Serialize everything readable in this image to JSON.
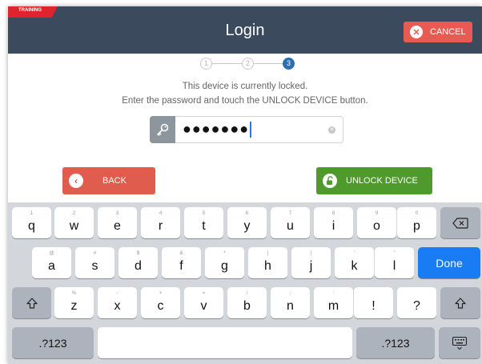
{
  "header": {
    "training_label": "TRAINING",
    "title": "Login",
    "cancel_label": "CANCEL"
  },
  "steps": [
    "1",
    "2",
    "3"
  ],
  "active_step": 3,
  "message": {
    "line1": "This device is currently locked.",
    "line2": "Enter the password and touch the UNLOCK DEVICE button."
  },
  "password": {
    "masked_value": "●●●●●●●"
  },
  "buttons": {
    "back_label": "BACK",
    "unlock_label": "UNLOCK DEVICE"
  },
  "keyboard": {
    "row1": [
      {
        "main": "q",
        "sub": "1"
      },
      {
        "main": "w",
        "sub": "2"
      },
      {
        "main": "e",
        "sub": "3"
      },
      {
        "main": "r",
        "sub": "4"
      },
      {
        "main": "t",
        "sub": "5"
      },
      {
        "main": "y",
        "sub": "6"
      },
      {
        "main": "u",
        "sub": "7"
      },
      {
        "main": "i",
        "sub": "8"
      },
      {
        "main": "o",
        "sub": "9"
      },
      {
        "main": "p",
        "sub": "0"
      }
    ],
    "row2": [
      {
        "main": "a",
        "sub": "@"
      },
      {
        "main": "s",
        "sub": "#"
      },
      {
        "main": "d",
        "sub": "$"
      },
      {
        "main": "f",
        "sub": "&"
      },
      {
        "main": "g",
        "sub": "*"
      },
      {
        "main": "h",
        "sub": "("
      },
      {
        "main": "j",
        "sub": ")"
      },
      {
        "main": "k",
        "sub": "'"
      },
      {
        "main": "l",
        "sub": "\""
      }
    ],
    "row3": [
      {
        "main": "z",
        "sub": "%"
      },
      {
        "main": "x",
        "sub": "-"
      },
      {
        "main": "c",
        "sub": "+"
      },
      {
        "main": "v",
        "sub": "="
      },
      {
        "main": "b",
        "sub": "/"
      },
      {
        "main": "n",
        "sub": ";"
      },
      {
        "main": "m",
        "sub": ":"
      },
      {
        "main": "!",
        "sub": ""
      },
      {
        "main": "?",
        "sub": ""
      }
    ],
    "done_label": "Done",
    "numbers_label": ".?123",
    "numbers_label_right": ".?123",
    "backspace_icon": "backspace-icon",
    "shift_icon": "shift-icon",
    "hide_keyboard_icon": "keyboard-dismiss-icon"
  },
  "colors": {
    "header_bg": "#3b4a5c",
    "cancel_red": "#e85b52",
    "back_red": "#e05c4c",
    "unlock_green": "#4e9a2c",
    "step_active": "#2c6fb0",
    "done_blue": "#1a7cf5"
  }
}
